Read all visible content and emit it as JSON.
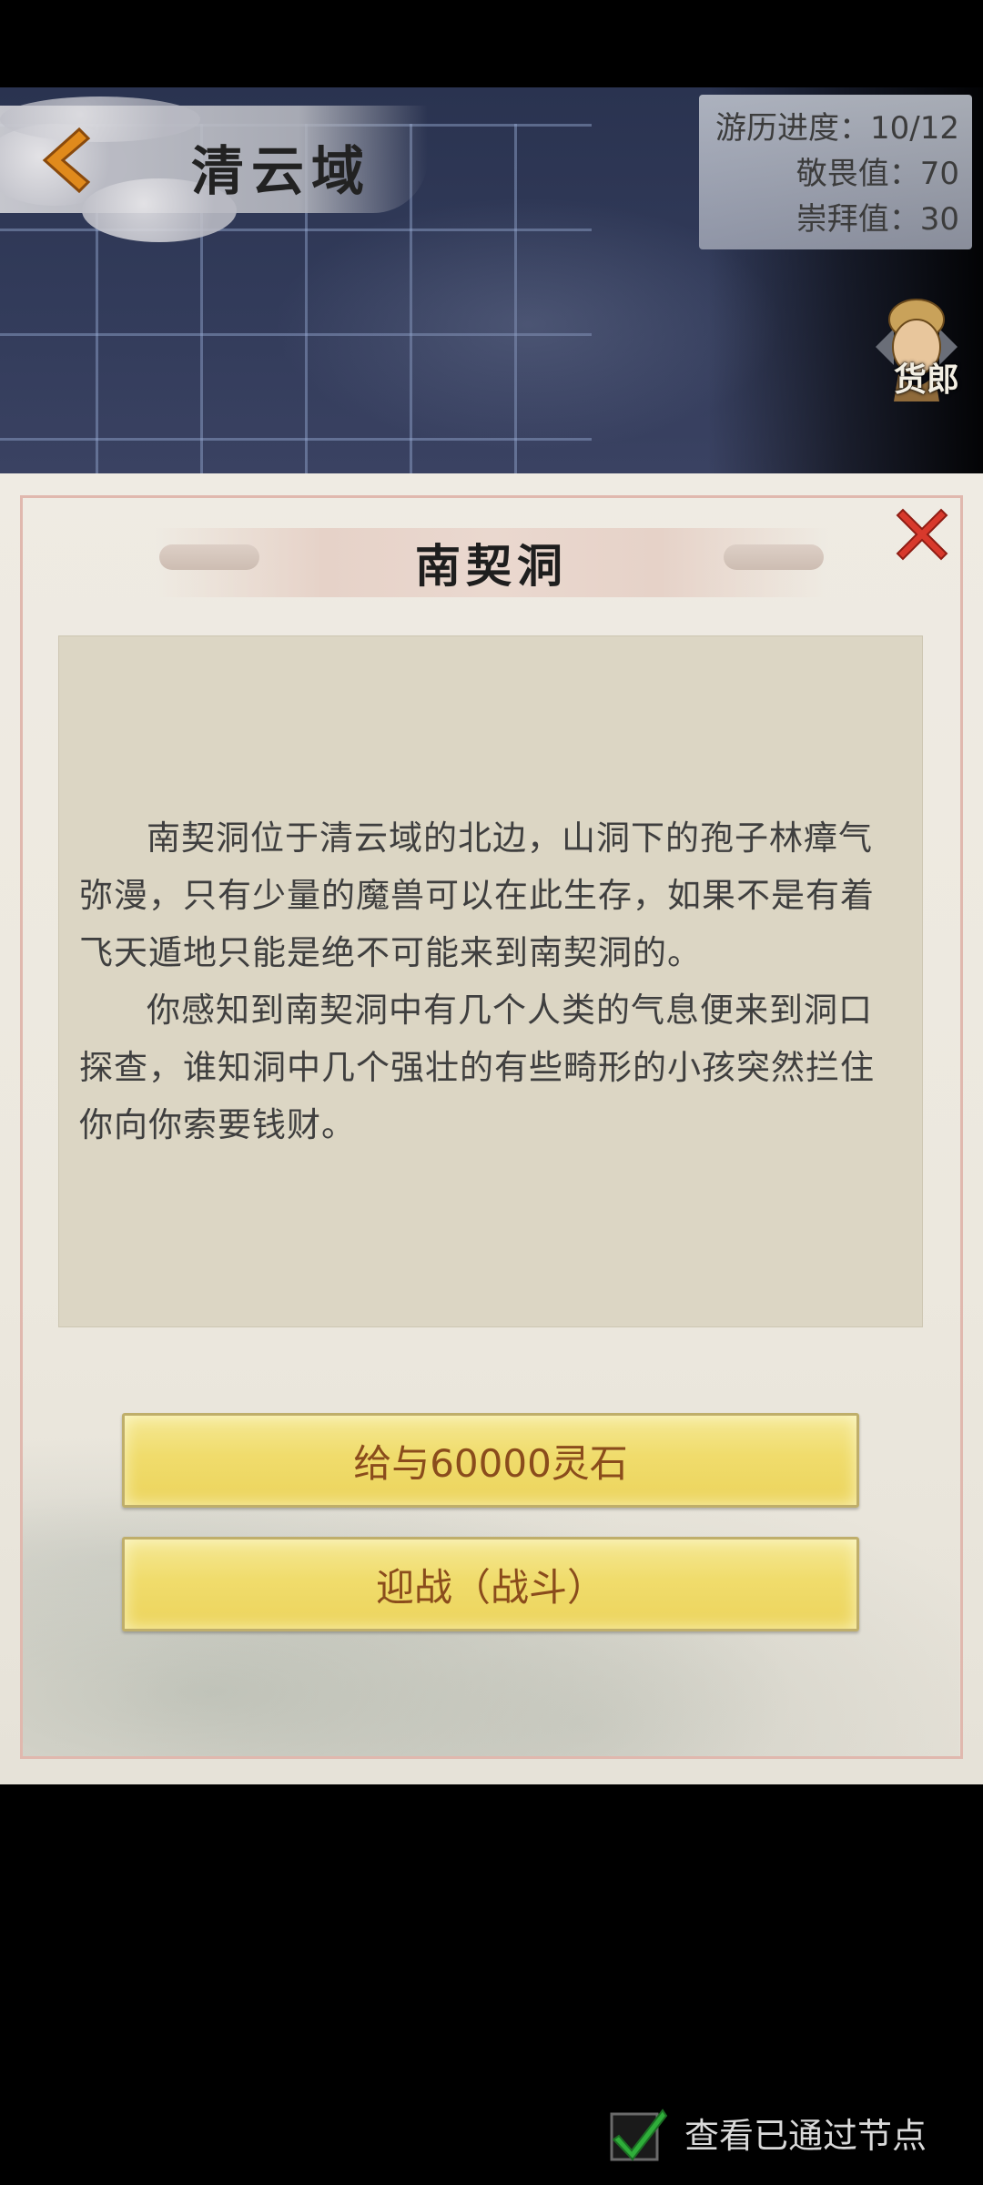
{
  "header": {
    "region_title": "清云域",
    "stats": [
      {
        "label": "游历进度：",
        "value": "10/12"
      },
      {
        "label": "敬畏值：",
        "value": "70"
      },
      {
        "label": "崇拜值：",
        "value": "30"
      }
    ],
    "merchant_label": "货郎"
  },
  "dialog": {
    "title": "南契洞",
    "paragraphs": [
      "南契洞位于清云域的北边，山洞下的孢子林瘴气弥漫，只有少量的魔兽可以在此生存，如果不是有着飞天遁地只能是绝不可能来到南契洞的。",
      "你感知到南契洞中有几个人类的气息便来到洞口探查，谁知洞中几个强壮的有些畸形的小孩突然拦住你向你索要钱财。"
    ],
    "choices": [
      {
        "label": "给与60000灵石"
      },
      {
        "label": "迎战（战斗）"
      }
    ]
  },
  "footer": {
    "checkbox_label": "查看已通过节点",
    "checked": true
  },
  "colors": {
    "accent_gold": "#f0dc6c",
    "choice_text": "#8a4c1c",
    "close_red": "#d8392c",
    "check_green": "#2fae3a"
  }
}
